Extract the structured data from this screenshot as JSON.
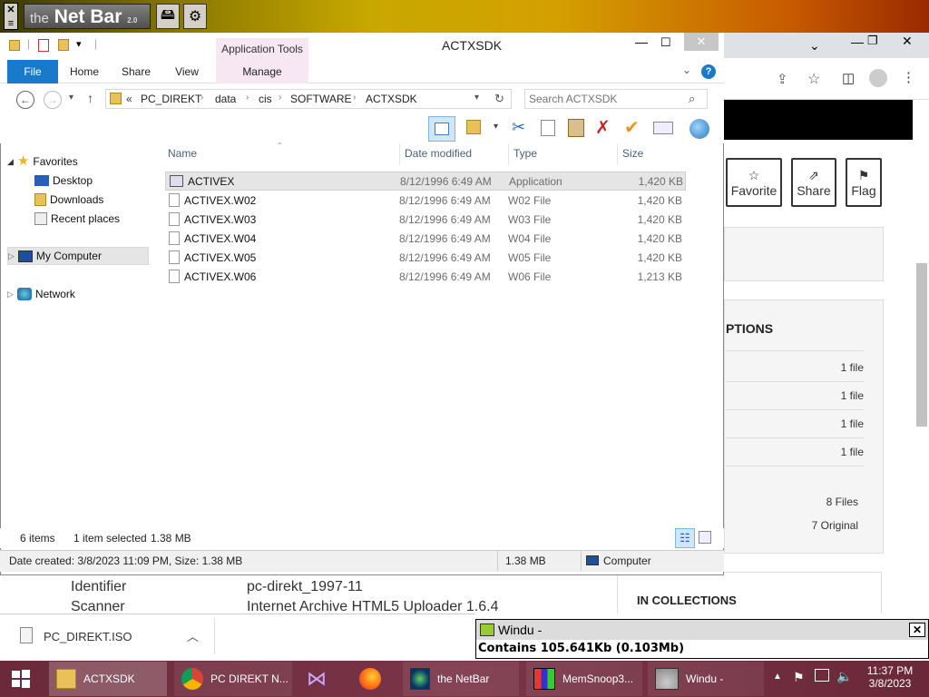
{
  "netbar": {
    "logo_prefix": "the",
    "logo_name": "Net Bar",
    "logo_version": "2.0"
  },
  "explorer": {
    "title": "ACTXSDK",
    "app_tools_label": "Application Tools",
    "tabs": [
      "File",
      "Home",
      "Share",
      "View",
      "Manage"
    ],
    "breadcrumb_overflow": "«",
    "breadcrumb": [
      "PC_DIREKT",
      "data",
      "cis",
      "SOFTWARE",
      "ACTXSDK"
    ],
    "search_placeholder": "Search ACTXSDK",
    "nav": {
      "favorites": "Favorites",
      "desktop": "Desktop",
      "downloads": "Downloads",
      "recent": "Recent places",
      "mycomputer": "My Computer",
      "network": "Network"
    },
    "columns": {
      "name": "Name",
      "date": "Date modified",
      "type": "Type",
      "size": "Size"
    },
    "files": [
      {
        "name": "ACTIVEX",
        "date": "8/12/1996 6:49 AM",
        "type": "Application",
        "size": "1,420 KB"
      },
      {
        "name": "ACTIVEX.W02",
        "date": "8/12/1996 6:49 AM",
        "type": "W02 File",
        "size": "1,420 KB"
      },
      {
        "name": "ACTIVEX.W03",
        "date": "8/12/1996 6:49 AM",
        "type": "W03 File",
        "size": "1,420 KB"
      },
      {
        "name": "ACTIVEX.W04",
        "date": "8/12/1996 6:49 AM",
        "type": "W04 File",
        "size": "1,420 KB"
      },
      {
        "name": "ACTIVEX.W05",
        "date": "8/12/1996 6:49 AM",
        "type": "W05 File",
        "size": "1,420 KB"
      },
      {
        "name": "ACTIVEX.W06",
        "date": "8/12/1996 6:49 AM",
        "type": "W06 File",
        "size": "1,213 KB"
      }
    ],
    "status": {
      "items": "6 items",
      "selected": "1 item selected",
      "selected_size": "1.38 MB"
    },
    "details": {
      "created": "Date created: 3/8/2023 11:09 PM, Size: 1.38 MB",
      "size": "1.38 MB",
      "location": "Computer"
    }
  },
  "browser": {
    "actions": [
      "Favorite",
      "Share",
      "Flag"
    ],
    "options_heading": "PTIONS",
    "file_rows": [
      "1 file",
      "1 file",
      "1 file",
      "1 file"
    ],
    "files_count": "8 Files",
    "original_count": "7 Original",
    "collections_heading": "IN COLLECTIONS",
    "meta": [
      {
        "label": "Identifier",
        "value": "pc-direkt_1997-11"
      },
      {
        "label": "Scanner",
        "value": "Internet Archive HTML5 Uploader 1.6.4"
      }
    ]
  },
  "download": {
    "filename": "PC_DIREKT.ISO"
  },
  "windu": {
    "title": "Windu -",
    "body": "Contains 105.641Kb (0.103Mb)"
  },
  "taskbar": {
    "items": [
      "ACTXSDK",
      "PC DIREKT N...",
      "the NetBar",
      "MemSnoop3...",
      "Windu -"
    ],
    "time": "11:37 PM",
    "date": "3/8/2023"
  }
}
